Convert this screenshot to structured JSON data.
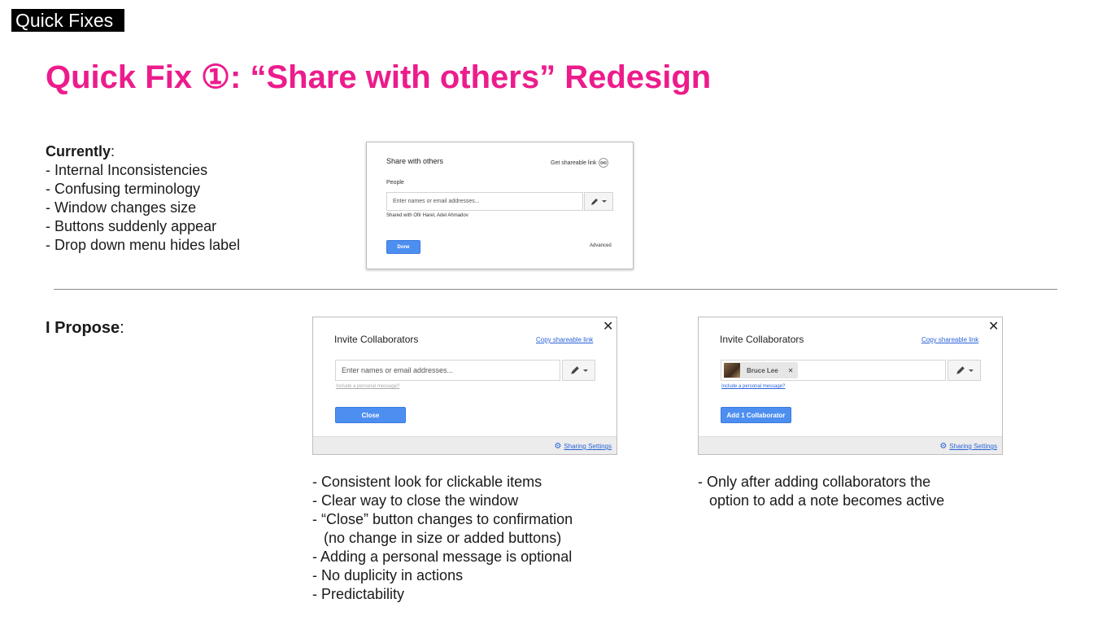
{
  "tag": "Quick Fixes",
  "title": "Quick Fix ①: “Share with others” Redesign",
  "currently": {
    "label": "Currently",
    "colon": ":",
    "items": [
      "- Internal Inconsistencies",
      "- Confusing terminology",
      "- Window changes size",
      "- Buttons suddenly appear",
      "- Drop down menu hides label"
    ]
  },
  "old_dialog": {
    "title": "Share with others",
    "shareable_link": "Get shareable link",
    "people_label": "People",
    "input_placeholder": "Enter names or email addresses...",
    "shared_with": "Shared with Ofir Harel, Adel Ahmadov",
    "done_button": "Done",
    "advanced_link": "Advanced"
  },
  "propose": {
    "label": "I Propose",
    "colon": ":"
  },
  "dialog_a": {
    "title": "Invite Collaborators",
    "copy_link": "Copy shareable link",
    "close_x": "✕",
    "input_placeholder": "Enter names or email addresses...",
    "personal_message": "Include a personal message?",
    "action_button": "Close",
    "sharing_settings": "Sharing Settings"
  },
  "dialog_b": {
    "title": "Invite Collaborators",
    "copy_link": "Copy shareable link",
    "close_x": "✕",
    "chip_name": "Bruce Lee",
    "chip_remove": "✕",
    "personal_message": "Include a personal message?",
    "action_button": "Add 1 Collaborator",
    "sharing_settings": "Sharing Settings"
  },
  "notes_a": [
    "- Consistent look for clickable items",
    "- Clear way to close the window",
    "- “Close” button changes to confirmation",
    "(no change in size or added buttons)",
    "- Adding a personal message is optional",
    "- No duplicity in actions",
    "- Predictability"
  ],
  "notes_b": [
    "- Only after adding collaborators the",
    "option to add a note becomes active"
  ],
  "colors": {
    "title": "#ec1c8c",
    "button_blue": "#4d8ff0",
    "link_blue": "#2a63d8"
  },
  "icons": [
    "pencil-icon",
    "link-icon",
    "gear-icon",
    "close-icon",
    "chevron-down-icon",
    "avatar"
  ]
}
